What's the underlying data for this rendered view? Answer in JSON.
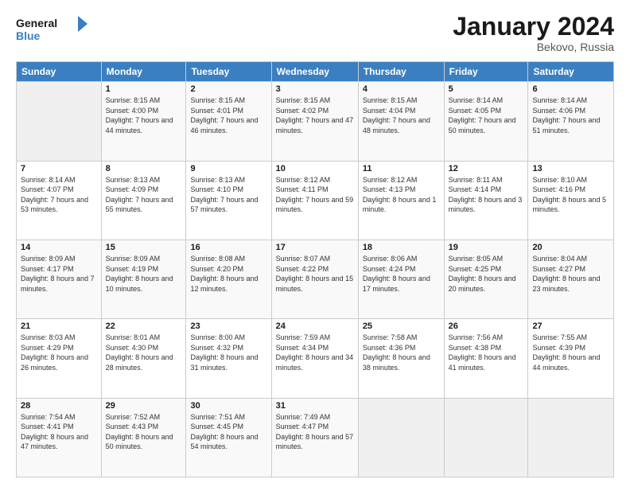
{
  "header": {
    "logo_line1": "General",
    "logo_line2": "Blue",
    "month_title": "January 2024",
    "location": "Bekovo, Russia"
  },
  "weekdays": [
    "Sunday",
    "Monday",
    "Tuesday",
    "Wednesday",
    "Thursday",
    "Friday",
    "Saturday"
  ],
  "weeks": [
    [
      {
        "day": "",
        "sunrise": "",
        "sunset": "",
        "daylight": ""
      },
      {
        "day": "1",
        "sunrise": "Sunrise: 8:15 AM",
        "sunset": "Sunset: 4:00 PM",
        "daylight": "Daylight: 7 hours and 44 minutes."
      },
      {
        "day": "2",
        "sunrise": "Sunrise: 8:15 AM",
        "sunset": "Sunset: 4:01 PM",
        "daylight": "Daylight: 7 hours and 46 minutes."
      },
      {
        "day": "3",
        "sunrise": "Sunrise: 8:15 AM",
        "sunset": "Sunset: 4:02 PM",
        "daylight": "Daylight: 7 hours and 47 minutes."
      },
      {
        "day": "4",
        "sunrise": "Sunrise: 8:15 AM",
        "sunset": "Sunset: 4:04 PM",
        "daylight": "Daylight: 7 hours and 48 minutes."
      },
      {
        "day": "5",
        "sunrise": "Sunrise: 8:14 AM",
        "sunset": "Sunset: 4:05 PM",
        "daylight": "Daylight: 7 hours and 50 minutes."
      },
      {
        "day": "6",
        "sunrise": "Sunrise: 8:14 AM",
        "sunset": "Sunset: 4:06 PM",
        "daylight": "Daylight: 7 hours and 51 minutes."
      }
    ],
    [
      {
        "day": "7",
        "sunrise": "Sunrise: 8:14 AM",
        "sunset": "Sunset: 4:07 PM",
        "daylight": "Daylight: 7 hours and 53 minutes."
      },
      {
        "day": "8",
        "sunrise": "Sunrise: 8:13 AM",
        "sunset": "Sunset: 4:09 PM",
        "daylight": "Daylight: 7 hours and 55 minutes."
      },
      {
        "day": "9",
        "sunrise": "Sunrise: 8:13 AM",
        "sunset": "Sunset: 4:10 PM",
        "daylight": "Daylight: 7 hours and 57 minutes."
      },
      {
        "day": "10",
        "sunrise": "Sunrise: 8:12 AM",
        "sunset": "Sunset: 4:11 PM",
        "daylight": "Daylight: 7 hours and 59 minutes."
      },
      {
        "day": "11",
        "sunrise": "Sunrise: 8:12 AM",
        "sunset": "Sunset: 4:13 PM",
        "daylight": "Daylight: 8 hours and 1 minute."
      },
      {
        "day": "12",
        "sunrise": "Sunrise: 8:11 AM",
        "sunset": "Sunset: 4:14 PM",
        "daylight": "Daylight: 8 hours and 3 minutes."
      },
      {
        "day": "13",
        "sunrise": "Sunrise: 8:10 AM",
        "sunset": "Sunset: 4:16 PM",
        "daylight": "Daylight: 8 hours and 5 minutes."
      }
    ],
    [
      {
        "day": "14",
        "sunrise": "Sunrise: 8:09 AM",
        "sunset": "Sunset: 4:17 PM",
        "daylight": "Daylight: 8 hours and 7 minutes."
      },
      {
        "day": "15",
        "sunrise": "Sunrise: 8:09 AM",
        "sunset": "Sunset: 4:19 PM",
        "daylight": "Daylight: 8 hours and 10 minutes."
      },
      {
        "day": "16",
        "sunrise": "Sunrise: 8:08 AM",
        "sunset": "Sunset: 4:20 PM",
        "daylight": "Daylight: 8 hours and 12 minutes."
      },
      {
        "day": "17",
        "sunrise": "Sunrise: 8:07 AM",
        "sunset": "Sunset: 4:22 PM",
        "daylight": "Daylight: 8 hours and 15 minutes."
      },
      {
        "day": "18",
        "sunrise": "Sunrise: 8:06 AM",
        "sunset": "Sunset: 4:24 PM",
        "daylight": "Daylight: 8 hours and 17 minutes."
      },
      {
        "day": "19",
        "sunrise": "Sunrise: 8:05 AM",
        "sunset": "Sunset: 4:25 PM",
        "daylight": "Daylight: 8 hours and 20 minutes."
      },
      {
        "day": "20",
        "sunrise": "Sunrise: 8:04 AM",
        "sunset": "Sunset: 4:27 PM",
        "daylight": "Daylight: 8 hours and 23 minutes."
      }
    ],
    [
      {
        "day": "21",
        "sunrise": "Sunrise: 8:03 AM",
        "sunset": "Sunset: 4:29 PM",
        "daylight": "Daylight: 8 hours and 26 minutes."
      },
      {
        "day": "22",
        "sunrise": "Sunrise: 8:01 AM",
        "sunset": "Sunset: 4:30 PM",
        "daylight": "Daylight: 8 hours and 28 minutes."
      },
      {
        "day": "23",
        "sunrise": "Sunrise: 8:00 AM",
        "sunset": "Sunset: 4:32 PM",
        "daylight": "Daylight: 8 hours and 31 minutes."
      },
      {
        "day": "24",
        "sunrise": "Sunrise: 7:59 AM",
        "sunset": "Sunset: 4:34 PM",
        "daylight": "Daylight: 8 hours and 34 minutes."
      },
      {
        "day": "25",
        "sunrise": "Sunrise: 7:58 AM",
        "sunset": "Sunset: 4:36 PM",
        "daylight": "Daylight: 8 hours and 38 minutes."
      },
      {
        "day": "26",
        "sunrise": "Sunrise: 7:56 AM",
        "sunset": "Sunset: 4:38 PM",
        "daylight": "Daylight: 8 hours and 41 minutes."
      },
      {
        "day": "27",
        "sunrise": "Sunrise: 7:55 AM",
        "sunset": "Sunset: 4:39 PM",
        "daylight": "Daylight: 8 hours and 44 minutes."
      }
    ],
    [
      {
        "day": "28",
        "sunrise": "Sunrise: 7:54 AM",
        "sunset": "Sunset: 4:41 PM",
        "daylight": "Daylight: 8 hours and 47 minutes."
      },
      {
        "day": "29",
        "sunrise": "Sunrise: 7:52 AM",
        "sunset": "Sunset: 4:43 PM",
        "daylight": "Daylight: 8 hours and 50 minutes."
      },
      {
        "day": "30",
        "sunrise": "Sunrise: 7:51 AM",
        "sunset": "Sunset: 4:45 PM",
        "daylight": "Daylight: 8 hours and 54 minutes."
      },
      {
        "day": "31",
        "sunrise": "Sunrise: 7:49 AM",
        "sunset": "Sunset: 4:47 PM",
        "daylight": "Daylight: 8 hours and 57 minutes."
      },
      {
        "day": "",
        "sunrise": "",
        "sunset": "",
        "daylight": ""
      },
      {
        "day": "",
        "sunrise": "",
        "sunset": "",
        "daylight": ""
      },
      {
        "day": "",
        "sunrise": "",
        "sunset": "",
        "daylight": ""
      }
    ]
  ]
}
